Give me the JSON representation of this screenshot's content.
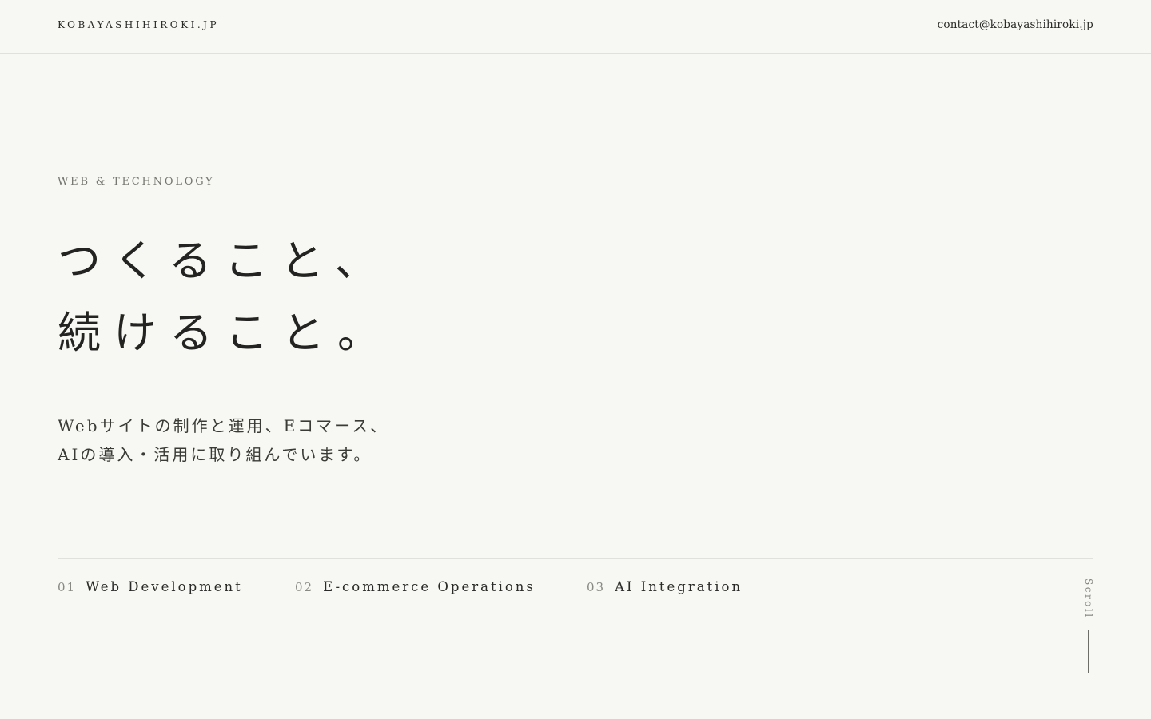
{
  "header": {
    "site_title": "KOBAYASHIHIROKI.JP",
    "contact_email": "contact@kobayashihiroki.jp"
  },
  "hero": {
    "eyebrow": "WEB & TECHNOLOGY",
    "headline": {
      "line1": "つくること、",
      "line2": "続けること。"
    },
    "lead": {
      "line1": "Webサイトの制作と運用、Eコマース、",
      "line2": "AIの導入・活用に取り組んでいます。"
    }
  },
  "services": [
    {
      "number": "01",
      "label": "Web Development"
    },
    {
      "number": "02",
      "label": "E-commerce Operations"
    },
    {
      "number": "03",
      "label": "AI Integration"
    }
  ],
  "scroll_indicator": {
    "label": "Scroll"
  },
  "colors": {
    "background": "#f7f7f3",
    "text": "#1f1f1d",
    "muted": "#85857f",
    "divider": "#e0e0dc"
  }
}
